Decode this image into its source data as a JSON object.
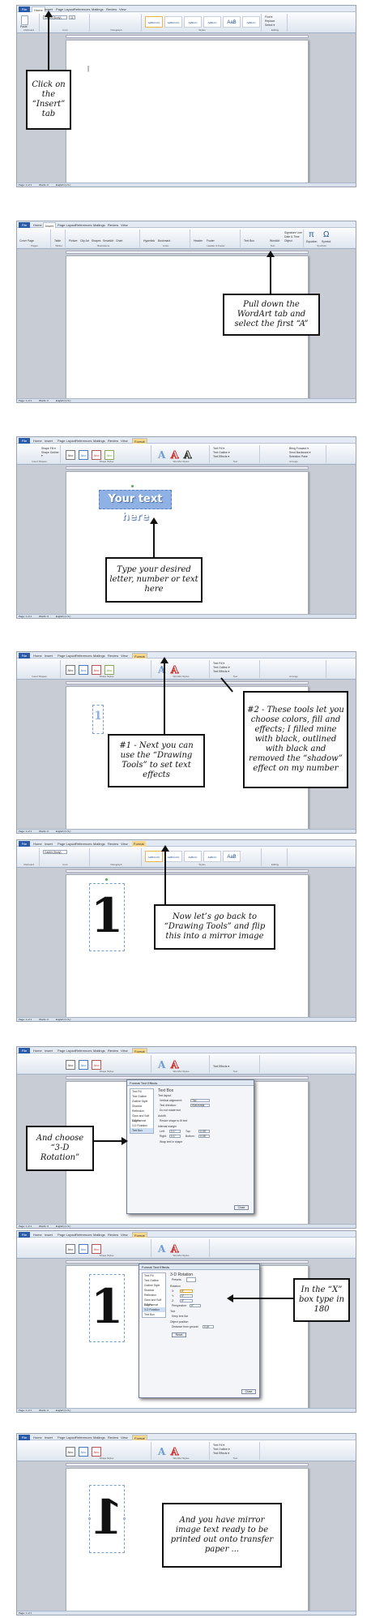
{
  "tabs": {
    "file": "File",
    "home": "Home",
    "insert": "Insert",
    "page_layout": "Page Layout",
    "references": "References",
    "mailings": "Mailings",
    "review": "Review",
    "view": "View",
    "format": "Format"
  },
  "ribbon_home": {
    "paste": "Paste",
    "font_name": "Calibri (Body)",
    "font_size": "11",
    "groups": [
      "Clipboard",
      "Font",
      "Paragraph",
      "Styles",
      "Editing"
    ],
    "styles": [
      "AaBbCcDc",
      "AaBbCcDc",
      "AaBbCc",
      "AaBbCc",
      "AaB",
      "AaBbCc"
    ],
    "style_names": [
      "¶ Normal",
      "¶ No Spaci...",
      "Heading 1",
      "Heading 2",
      "Title",
      "Subtitle"
    ],
    "editing": [
      "Find ▾",
      "Replace",
      "Select ▾"
    ]
  },
  "ribbon_insert": {
    "groups": [
      "Pages",
      "Tables",
      "Illustrations",
      "Links",
      "Header & Footer",
      "Text",
      "Symbols"
    ],
    "buttons": [
      "Cover Page",
      "Blank Page",
      "Page Break",
      "Table",
      "Picture",
      "Clip Art",
      "Shapes",
      "SmartArt",
      "Chart",
      "Screenshot",
      "Hyperlink",
      "Bookmark",
      "Cross-reference",
      "Header",
      "Footer",
      "Page Number",
      "Text Box",
      "Quick Parts",
      "WordArt",
      "Drop Cap"
    ],
    "right": [
      "Signature Line",
      "Date & Time",
      "Object"
    ],
    "symbols": [
      "Equation",
      "Symbol"
    ],
    "pi": "π",
    "omega": "Ω"
  },
  "ribbon_format": {
    "groups": [
      "Insert Shapes",
      "Shape Styles",
      "WordArt Styles",
      "Text",
      "Arrange",
      "Size"
    ],
    "shape_items": [
      "Shape Fill ▾",
      "Shape Outline ▾",
      "Change Shape ▾"
    ],
    "text_items": [
      "Text Fill ▾",
      "Text Outline ▾",
      "Text Effects ▾"
    ],
    "arrange_items": [
      "Position",
      "Wrap Text",
      "Bring Forward ▾",
      "Send Backward ▾",
      "Selection Pane"
    ],
    "abc": "Abc",
    "a": "A"
  },
  "status": {
    "page": "Page: 1 of 1",
    "words": "Words: 0",
    "lang": "English (U.S.)"
  },
  "document": {
    "cursor": "|",
    "wordart_text": "Your text here",
    "number": "1"
  },
  "callouts": {
    "c1": "Click on the “Insert” tab",
    "c2": "Pull down the WordArt tab and select the first “A”",
    "c3": "Type your desired letter, number or text here",
    "c4a": "#1 - Next you can use the “Drawing Tools” to set text effects",
    "c4b": "#2 - These tools let you choose colors, fill and effects; I filled mine with black, outlined with black and removed the “shadow” effect on my number",
    "c5": "Now let’s go back to “Drawing Tools” and flip this into a mirror image",
    "c6": "And choose “3-D Rotation”",
    "c7": "In the “X” box type in 180",
    "c8": "And you have mirror image text ready to be printed out onto transfer paper ..."
  },
  "dialog1": {
    "title": "Format Text Effects",
    "items": [
      "Text Fill",
      "Text Outline",
      "Outline Style",
      "Shadow",
      "Reflection",
      "Glow and Soft Edges",
      "3-D Format",
      "3-D Rotation",
      "Text Box"
    ],
    "heading": "Text Box",
    "layout": "Text layout",
    "valign": "Vertical alignment:",
    "valign_val": "Top",
    "tdir": "Text direction:",
    "tdir_val": "Horizontal",
    "unrotate": "Do not rotate text",
    "autofit": "Autofit",
    "resize": "Resize shape to fit text",
    "margin": "Internal margin",
    "left": "Left:",
    "right": "Right:",
    "top": "Top:",
    "bottom": "Bottom:",
    "m_lr": "0.1\"",
    "m_tb": "0.05\"",
    "wrap": "Wrap text in shape",
    "close": "Close"
  },
  "dialog2": {
    "title": "Format Text Effects",
    "items": [
      "Text Fill",
      "Text Outline",
      "Outline Style",
      "Shadow",
      "Reflection",
      "Glow and Soft Edges",
      "3-D Format",
      "3-D Rotation",
      "Text Box"
    ],
    "heading": "3-D Rotation",
    "presets": "Presets:",
    "rotation": "Rotation",
    "x": "X:",
    "y": "Y:",
    "z": "Z:",
    "perspective": "Perspective:",
    "deg": "0°",
    "text": "Text",
    "keep_flat": "Keep text flat",
    "object_position": "Object position",
    "distance": "Distance from ground:",
    "dist_val": "0 pt",
    "reset": "Reset",
    "close": "Close"
  },
  "colors": {
    "ribbon_blue": "#2a5aa8",
    "format_tab": "#f7d78a",
    "wordart_fill": "#8fb1e3"
  }
}
